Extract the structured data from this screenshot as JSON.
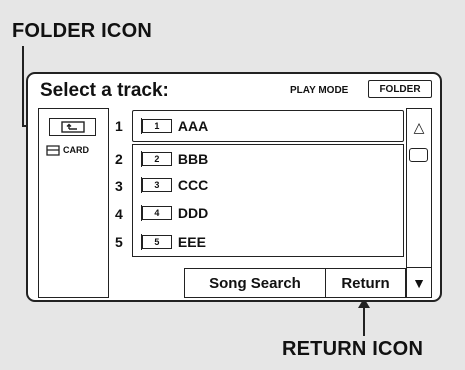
{
  "callouts": {
    "folder_icon": "FOLDER ICON",
    "return_icon": "RETURN ICON"
  },
  "header": {
    "title": "Select a track:",
    "play_mode_label": "PLAY MODE",
    "play_mode_button": "FOLDER"
  },
  "sidebar": {
    "up_folder_icon": "up-folder-icon",
    "card_label": "CARD"
  },
  "tracks": [
    {
      "number": "1",
      "folder_index": "1",
      "name": "AAA"
    },
    {
      "number": "2",
      "folder_index": "2",
      "name": "BBB"
    },
    {
      "number": "3",
      "folder_index": "3",
      "name": "CCC"
    },
    {
      "number": "4",
      "folder_index": "4",
      "name": "DDD"
    },
    {
      "number": "5",
      "folder_index": "5",
      "name": "EEE"
    }
  ],
  "footer": {
    "song_search": "Song Search",
    "return": "Return"
  },
  "scroll": {
    "up_glyph": "△",
    "down_glyph": "▼"
  }
}
